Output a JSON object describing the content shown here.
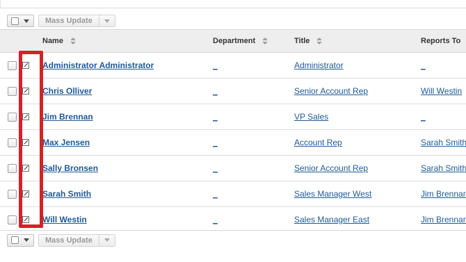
{
  "toolbar": {
    "mass_update_label": "Mass Update"
  },
  "table": {
    "columns": [
      "Name",
      "Department",
      "Title",
      "Reports To"
    ],
    "rows": [
      {
        "name": "Administrator Administrator",
        "department": "_",
        "title": "Administrator",
        "reports_to": "_"
      },
      {
        "name": "Chris Olliver",
        "department": "_",
        "title": "Senior Account Rep",
        "reports_to": "Will Westin"
      },
      {
        "name": "Jim Brennan",
        "department": "_",
        "title": "VP Sales",
        "reports_to": "_"
      },
      {
        "name": "Max Jensen",
        "department": "_",
        "title": "Account Rep",
        "reports_to": "Sarah Smith"
      },
      {
        "name": "Sally Bronsen",
        "department": "_",
        "title": "Senior Account Rep",
        "reports_to": "Sarah Smith"
      },
      {
        "name": "Sarah Smith",
        "department": "_",
        "title": "Sales Manager West",
        "reports_to": "Jim Brennan"
      },
      {
        "name": "Will Westin",
        "department": "_",
        "title": "Sales Manager East",
        "reports_to": "Jim Brennan"
      }
    ]
  },
  "colors": {
    "link": "#1e5a99",
    "highlight": "#d62127",
    "header_bg": "#eeeeee"
  },
  "icons": {
    "edit": "pencil-edit-icon",
    "sort": "sort-arrows-icon"
  }
}
